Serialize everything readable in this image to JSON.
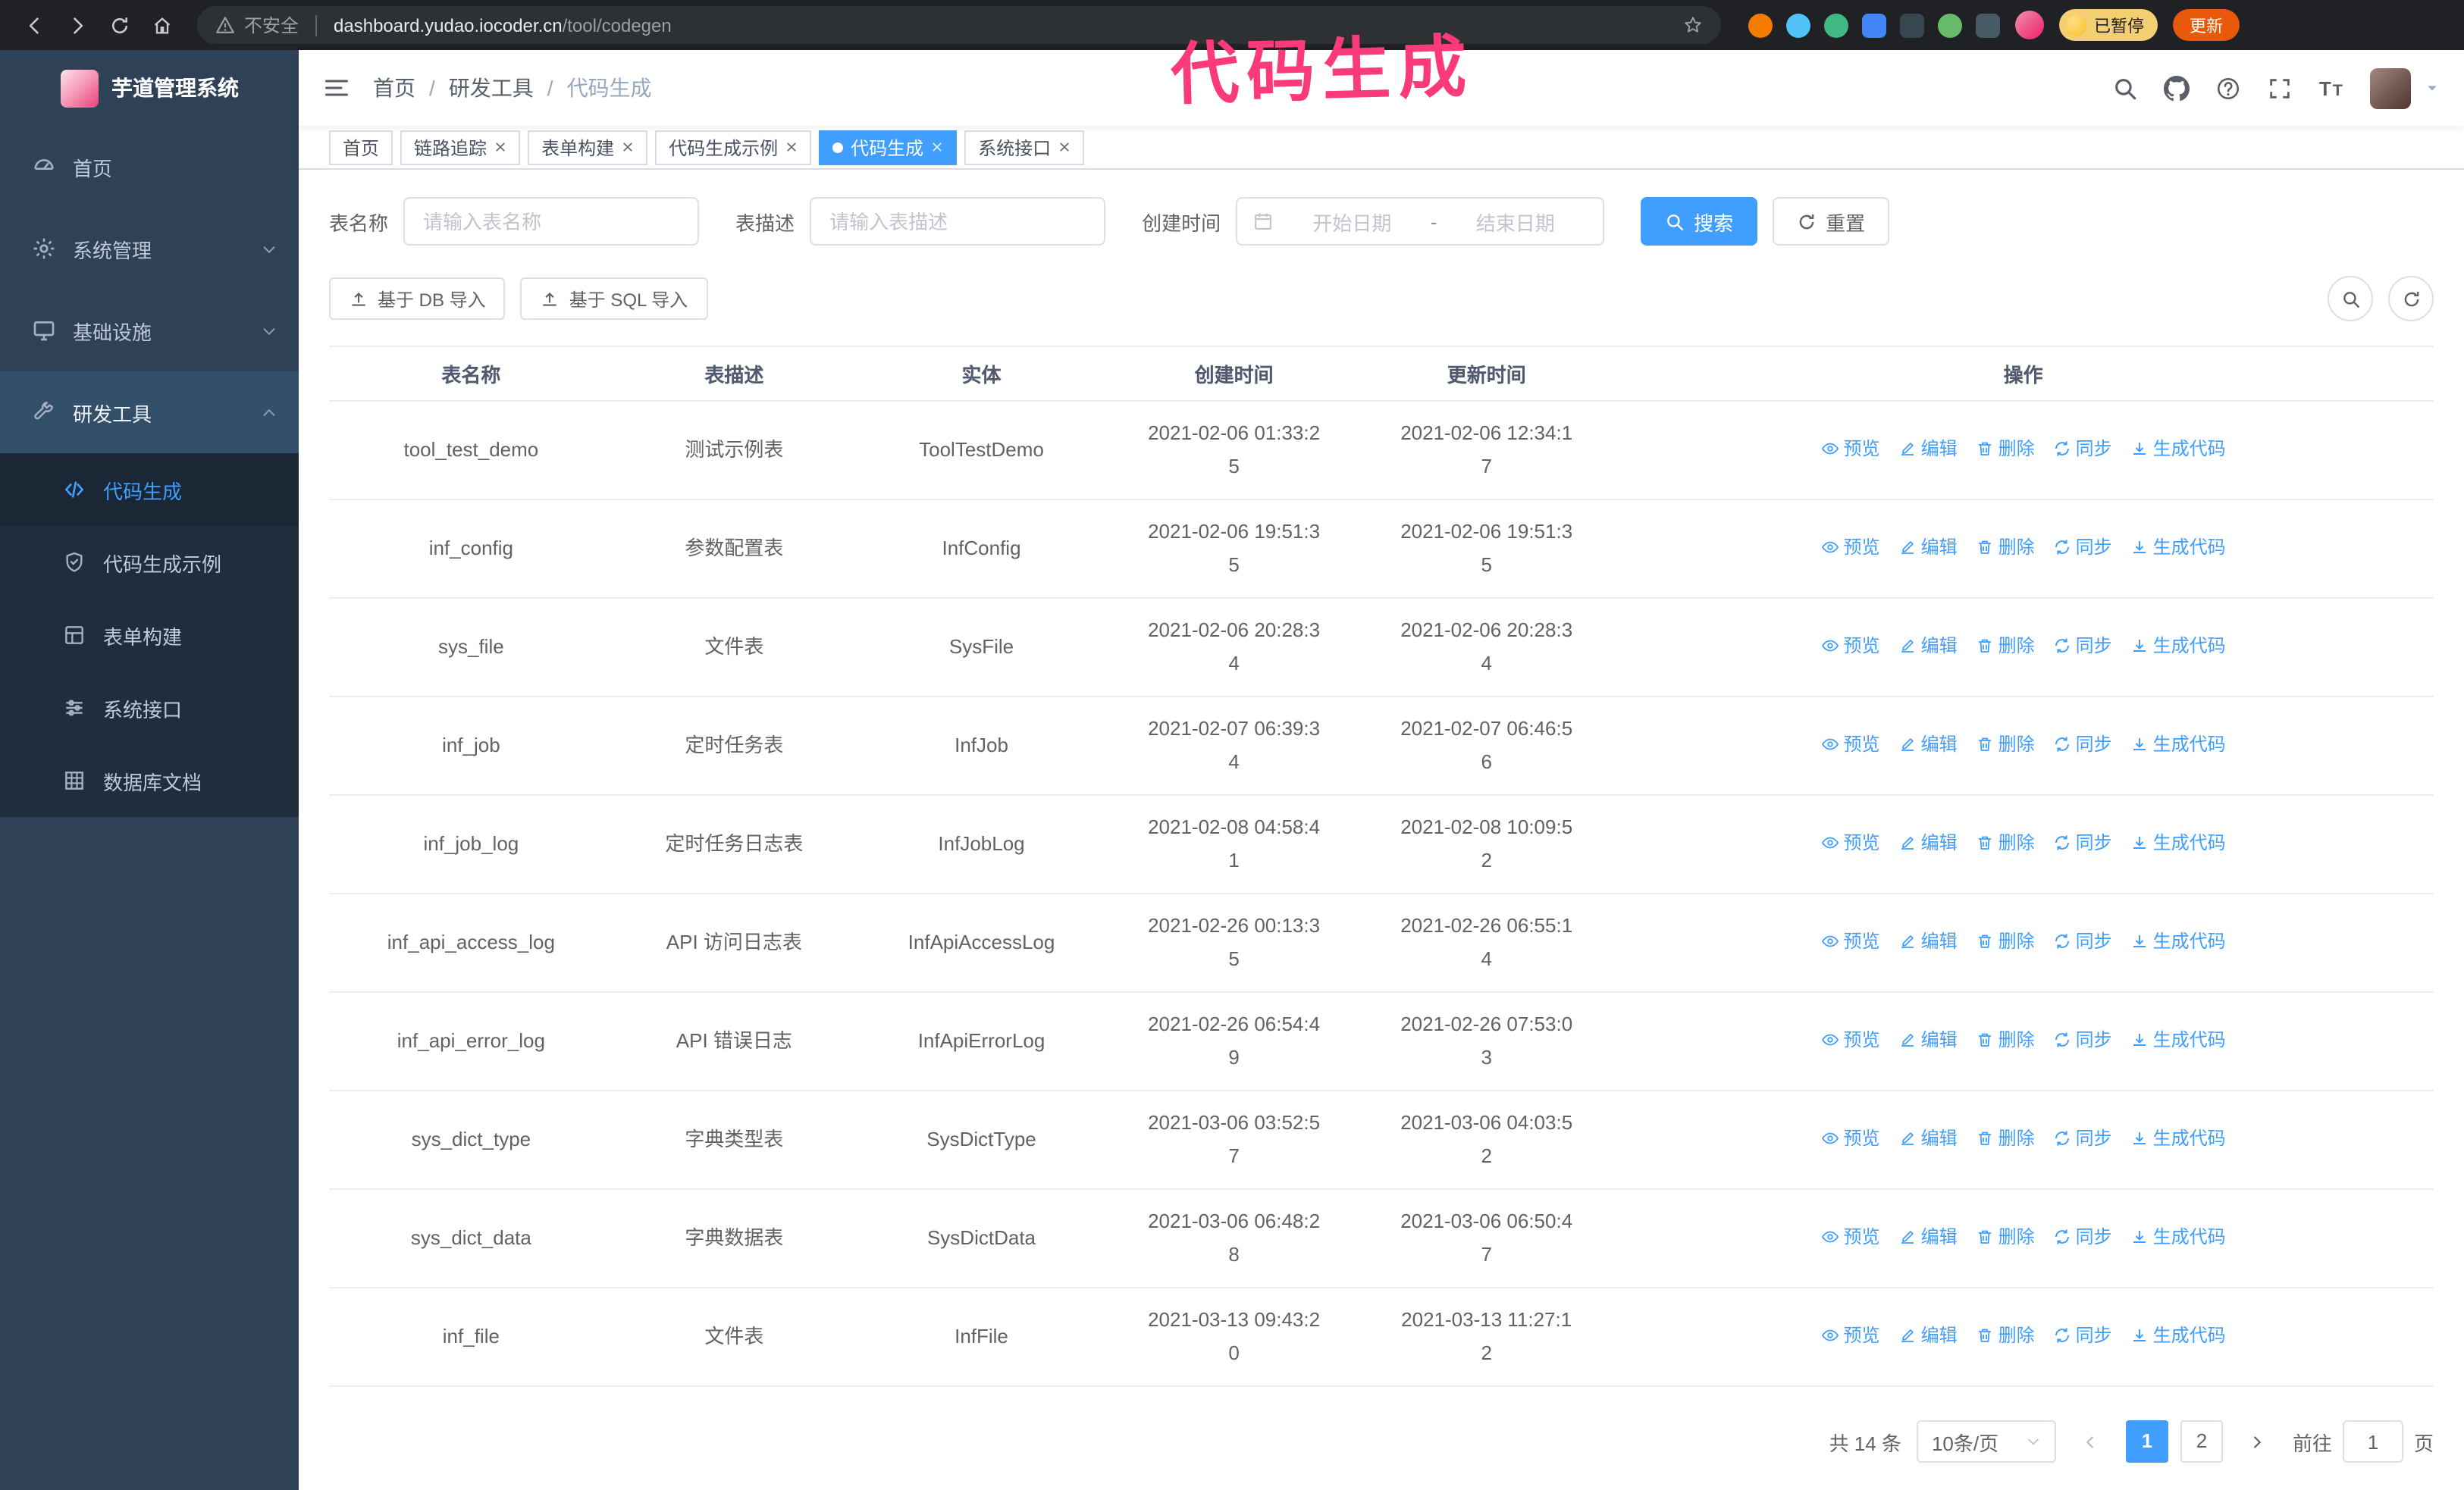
{
  "colors": {
    "accent": "#409eff",
    "annotation_pink": "#fb3a7a",
    "sidebar_bg": "#2f4156",
    "submenu_bg": "#1f2d3d"
  },
  "browser": {
    "security_label": "不安全",
    "url_host": "dashboard.yudao.iocoder.cn",
    "url_path": "/tool/codegen",
    "paused_badge": "已暂停",
    "update_button": "更新",
    "extensions": [
      {
        "key": "orange-extension",
        "color": "#f57c00",
        "shape": "circle"
      },
      {
        "key": "drop-extension",
        "color": "#4fc3f7",
        "shape": "circle"
      },
      {
        "key": "vue-devtools-extension",
        "color": "#41b883",
        "shape": "circle"
      },
      {
        "key": "grid-extension",
        "color": "#4285f4",
        "shape": "square"
      },
      {
        "key": "dark-extension",
        "color": "#37474f",
        "shape": "square"
      },
      {
        "key": "leaf-extension",
        "color": "#66bb6a",
        "shape": "circle"
      },
      {
        "key": "puzzle-extension",
        "color": "#455a64",
        "shape": "square"
      }
    ]
  },
  "annotation": {
    "text": "代码生成"
  },
  "sidebar": {
    "logo_title": "芋道管理系统",
    "items": [
      {
        "key": "home",
        "label": "首页",
        "icon": "dashboard",
        "level": 1
      },
      {
        "key": "system-management",
        "label": "系统管理",
        "icon": "gear",
        "level": 1,
        "chevron": "down"
      },
      {
        "key": "infrastructure",
        "label": "基础设施",
        "icon": "monitor",
        "level": 1,
        "chevron": "down"
      },
      {
        "key": "dev-tools",
        "label": "研发工具",
        "icon": "wrench",
        "level": 1,
        "chevron": "up",
        "open": true
      },
      {
        "key": "codegen",
        "label": "代码生成",
        "icon": "code",
        "level": 2,
        "active": true
      },
      {
        "key": "codegen-example",
        "label": "代码生成示例",
        "icon": "shield",
        "level": 2
      },
      {
        "key": "form-builder",
        "label": "表单构建",
        "icon": "form",
        "level": 2
      },
      {
        "key": "system-api",
        "label": "系统接口",
        "icon": "sliders",
        "level": 2
      },
      {
        "key": "db-doc",
        "label": "数据库文档",
        "icon": "dbgrid",
        "level": 2
      }
    ]
  },
  "header": {
    "breadcrumb": [
      "首页",
      "研发工具",
      "代码生成"
    ]
  },
  "tabs": [
    {
      "key": "home",
      "label": "首页",
      "closable": false,
      "active": false
    },
    {
      "key": "trace",
      "label": "链路追踪",
      "closable": true,
      "active": false
    },
    {
      "key": "form-builder",
      "label": "表单构建",
      "closable": true,
      "active": false
    },
    {
      "key": "codegen-example",
      "label": "代码生成示例",
      "closable": true,
      "active": false
    },
    {
      "key": "codegen",
      "label": "代码生成",
      "closable": true,
      "active": true
    },
    {
      "key": "system-api",
      "label": "系统接口",
      "closable": true,
      "active": false
    }
  ],
  "filters": {
    "table_name_label": "表名称",
    "table_name_placeholder": "请输入表名称",
    "table_desc_label": "表描述",
    "table_desc_placeholder": "请输入表描述",
    "create_time_label": "创建时间",
    "date_start_placeholder": "开始日期",
    "date_separator": "-",
    "date_end_placeholder": "结束日期",
    "search_button": "搜索",
    "reset_button": "重置"
  },
  "toolbar": {
    "import_db_button": "基于 DB 导入",
    "import_sql_button": "基于 SQL 导入"
  },
  "table": {
    "columns": [
      "表名称",
      "表描述",
      "实体",
      "创建时间",
      "更新时间",
      "操作"
    ],
    "rows": [
      {
        "name": "tool_test_demo",
        "desc": "测试示例表",
        "entity": "ToolTestDemo",
        "created": "2021-02-06 01:33:25",
        "updated": "2021-02-06 12:34:17"
      },
      {
        "name": "inf_config",
        "desc": "参数配置表",
        "entity": "InfConfig",
        "created": "2021-02-06 19:51:35",
        "updated": "2021-02-06 19:51:35"
      },
      {
        "name": "sys_file",
        "desc": "文件表",
        "entity": "SysFile",
        "created": "2021-02-06 20:28:34",
        "updated": "2021-02-06 20:28:34"
      },
      {
        "name": "inf_job",
        "desc": "定时任务表",
        "entity": "InfJob",
        "created": "2021-02-07 06:39:34",
        "updated": "2021-02-07 06:46:56"
      },
      {
        "name": "inf_job_log",
        "desc": "定时任务日志表",
        "entity": "InfJobLog",
        "created": "2021-02-08 04:58:41",
        "updated": "2021-02-08 10:09:52"
      },
      {
        "name": "inf_api_access_log",
        "desc": "API 访问日志表",
        "entity": "InfApiAccessLog",
        "created": "2021-02-26 00:13:35",
        "updated": "2021-02-26 06:55:14"
      },
      {
        "name": "inf_api_error_log",
        "desc": "API 错误日志",
        "entity": "InfApiErrorLog",
        "created": "2021-02-26 06:54:49",
        "updated": "2021-02-26 07:53:03"
      },
      {
        "name": "sys_dict_type",
        "desc": "字典类型表",
        "entity": "SysDictType",
        "created": "2021-03-06 03:52:57",
        "updated": "2021-03-06 04:03:52"
      },
      {
        "name": "sys_dict_data",
        "desc": "字典数据表",
        "entity": "SysDictData",
        "created": "2021-03-06 06:48:28",
        "updated": "2021-03-06 06:50:47"
      },
      {
        "name": "inf_file",
        "desc": "文件表",
        "entity": "InfFile",
        "created": "2021-03-13 09:43:20",
        "updated": "2021-03-13 11:27:12"
      }
    ],
    "row_actions": [
      {
        "key": "preview",
        "label": "预览",
        "icon": "eye"
      },
      {
        "key": "edit",
        "label": "编辑",
        "icon": "edit"
      },
      {
        "key": "delete",
        "label": "删除",
        "icon": "trash"
      },
      {
        "key": "sync",
        "label": "同步",
        "icon": "sync"
      },
      {
        "key": "generate",
        "label": "生成代码",
        "icon": "download"
      }
    ]
  },
  "pagination": {
    "total_text": "共 14 条",
    "page_size": "10条/页",
    "pages": [
      "1",
      "2"
    ],
    "active_page": "1",
    "goto_label": "前往",
    "goto_value": "1",
    "goto_suffix": "页"
  }
}
